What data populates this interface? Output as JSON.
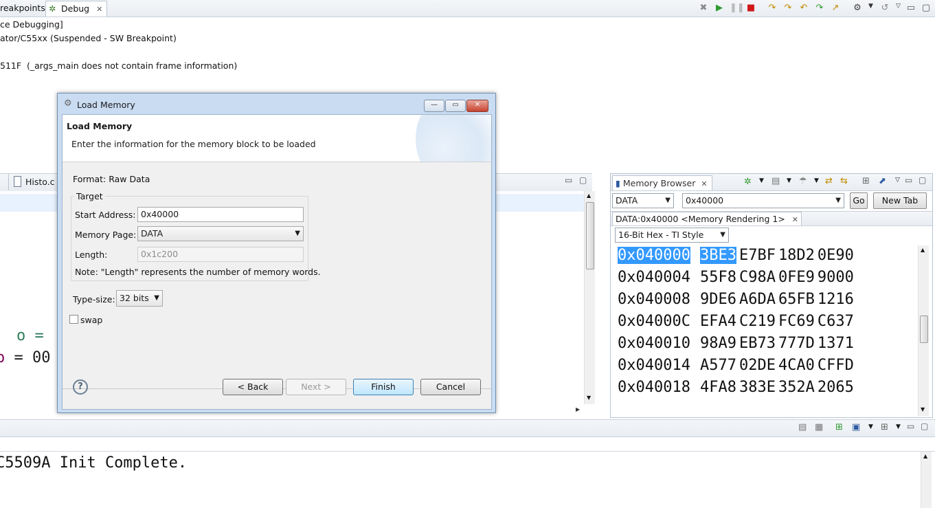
{
  "top": {
    "tabs": [
      {
        "label": "reakpoints"
      },
      {
        "label": "Debug"
      }
    ],
    "debug_lines": [
      "ce Debugging]",
      "ator/C55xx (Suspended - SW Breakpoint)",
      "511F  (_args_main does not contain frame information)"
    ]
  },
  "editor": {
    "tab_label": "Histo.c",
    "code_line1": "o =",
    "code_line2_var": "o",
    "code_line2_rest": " = 00"
  },
  "memory": {
    "tab_label": "Memory Browser",
    "page_select": "DATA",
    "address_input": "0x40000",
    "go_label": "Go",
    "new_tab_label": "New Tab",
    "rendering_tab": "DATA:0x40000 <Memory Rendering 1>",
    "format_select": "16-Bit Hex - TI Style",
    "rows": [
      {
        "addr": "0x040000",
        "w": [
          "3BE3",
          "E7BF",
          "18D2",
          "0E90"
        ]
      },
      {
        "addr": "0x040004",
        "w": [
          "55F8",
          "C98A",
          "0FE9",
          "9000"
        ]
      },
      {
        "addr": "0x040008",
        "w": [
          "9DE6",
          "A6DA",
          "65FB",
          "1216"
        ]
      },
      {
        "addr": "0x04000C",
        "w": [
          "EFA4",
          "C219",
          "FC69",
          "C637"
        ]
      },
      {
        "addr": "0x040010",
        "w": [
          "98A9",
          "EB73",
          "777D",
          "1371"
        ]
      },
      {
        "addr": "0x040014",
        "w": [
          "A577",
          "02DE",
          "4CA0",
          "CFFD"
        ]
      },
      {
        "addr": "0x040018",
        "w": [
          "4FA8",
          "383E",
          "352A",
          "2065"
        ]
      }
    ]
  },
  "console": {
    "text": "C5509A Init Complete."
  },
  "dialog": {
    "window_title": "Load Memory",
    "heading": "Load Memory",
    "description": "Enter the information for the memory block to be loaded",
    "format": "Format: Raw Data",
    "target_group": "Target",
    "start_address_label": "Start Address:",
    "start_address_value": "0x40000",
    "memory_page_label": "Memory Page:",
    "memory_page_value": "DATA",
    "length_label": "Length:",
    "length_placeholder": "0x1c200",
    "note": "Note: \"Length\" represents the number of memory words.",
    "type_size_label": "Type-size:",
    "type_size_value": "32 bits",
    "swap_label": "swap",
    "help_symbol": "?",
    "back_label": "< Back",
    "next_label": "Next >",
    "finish_label": "Finish",
    "cancel_label": "Cancel"
  },
  "colors": {
    "selection": "#3399ff",
    "code_green": "#2e7d5b",
    "code_purple": "#7f0055",
    "dialog_frame": "#c9dcf1"
  }
}
